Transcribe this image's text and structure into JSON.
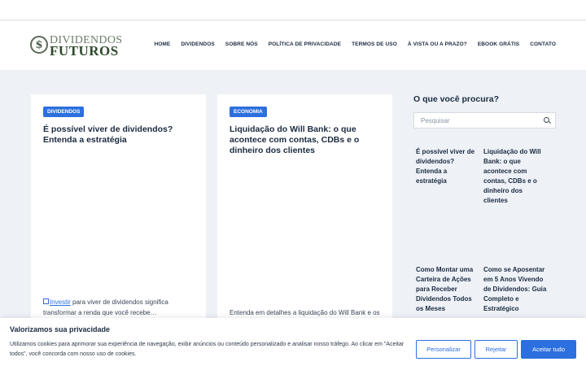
{
  "logo": {
    "symbol": "$",
    "line1": "DIVIDENDOS",
    "line2": "FUTUROS"
  },
  "nav": [
    {
      "label": "HOME"
    },
    {
      "label": "DIVIDENDOS"
    },
    {
      "label": "SOBRE NÓS"
    },
    {
      "label": "POLÍTICA DE PRIVACIDADE"
    },
    {
      "label": "TERMOS DE USO"
    },
    {
      "label": "À VISTA OU A PRAZO?"
    },
    {
      "label": "EBOOK GRÁTIS"
    },
    {
      "label": "CONTATO"
    }
  ],
  "posts": [
    {
      "category": "DIVIDENDOS",
      "title": "É possível viver de dividendos? Entenda a estratégia",
      "excerpt_link": "Investir",
      "excerpt": " para viver de dividendos significa transformar a renda que você recebe…"
    },
    {
      "category": "ECONOMIA",
      "title": "Liquidação do Will Bank: o que acontece com contas, CDBs e o dinheiro dos clientes",
      "excerpt": "Entenda em detalhes a liquidação do Will Bank e os"
    }
  ],
  "sidebar": {
    "title": "O que você procura?",
    "search_placeholder": "Pesquisar",
    "posts": [
      {
        "title": "É possível viver de dividendos? Entenda a estratégia"
      },
      {
        "title": "Liquidação do Will Bank: o que acontece com contas, CDBs e o dinheiro dos clientes"
      },
      {
        "title": "Como Montar uma Carteira de Ações para Receber Dividendos Todos os Meses"
      },
      {
        "title": "Como se Aposentar em 5 Anos Vivendo de Dividendos: Guia Completo e Estratégico"
      }
    ]
  },
  "cookie": {
    "title": "Valorizamos sua privacidade",
    "text": "Utilizamos cookies para aprimorar sua experiência de navegação, exibir anúncios ou conteúdo personalizado e analisar nosso tráfego. Ao clicar em \"Aceitar todos\", você concorda com nosso uso de cookies.",
    "customize_label": "Personalizar",
    "reject_label": "Rejeitar",
    "accept_label": "Aceitar tudo"
  },
  "colors": {
    "accent": "#2c6fdf",
    "background": "#eef2f7",
    "text": "#1b2a40"
  }
}
